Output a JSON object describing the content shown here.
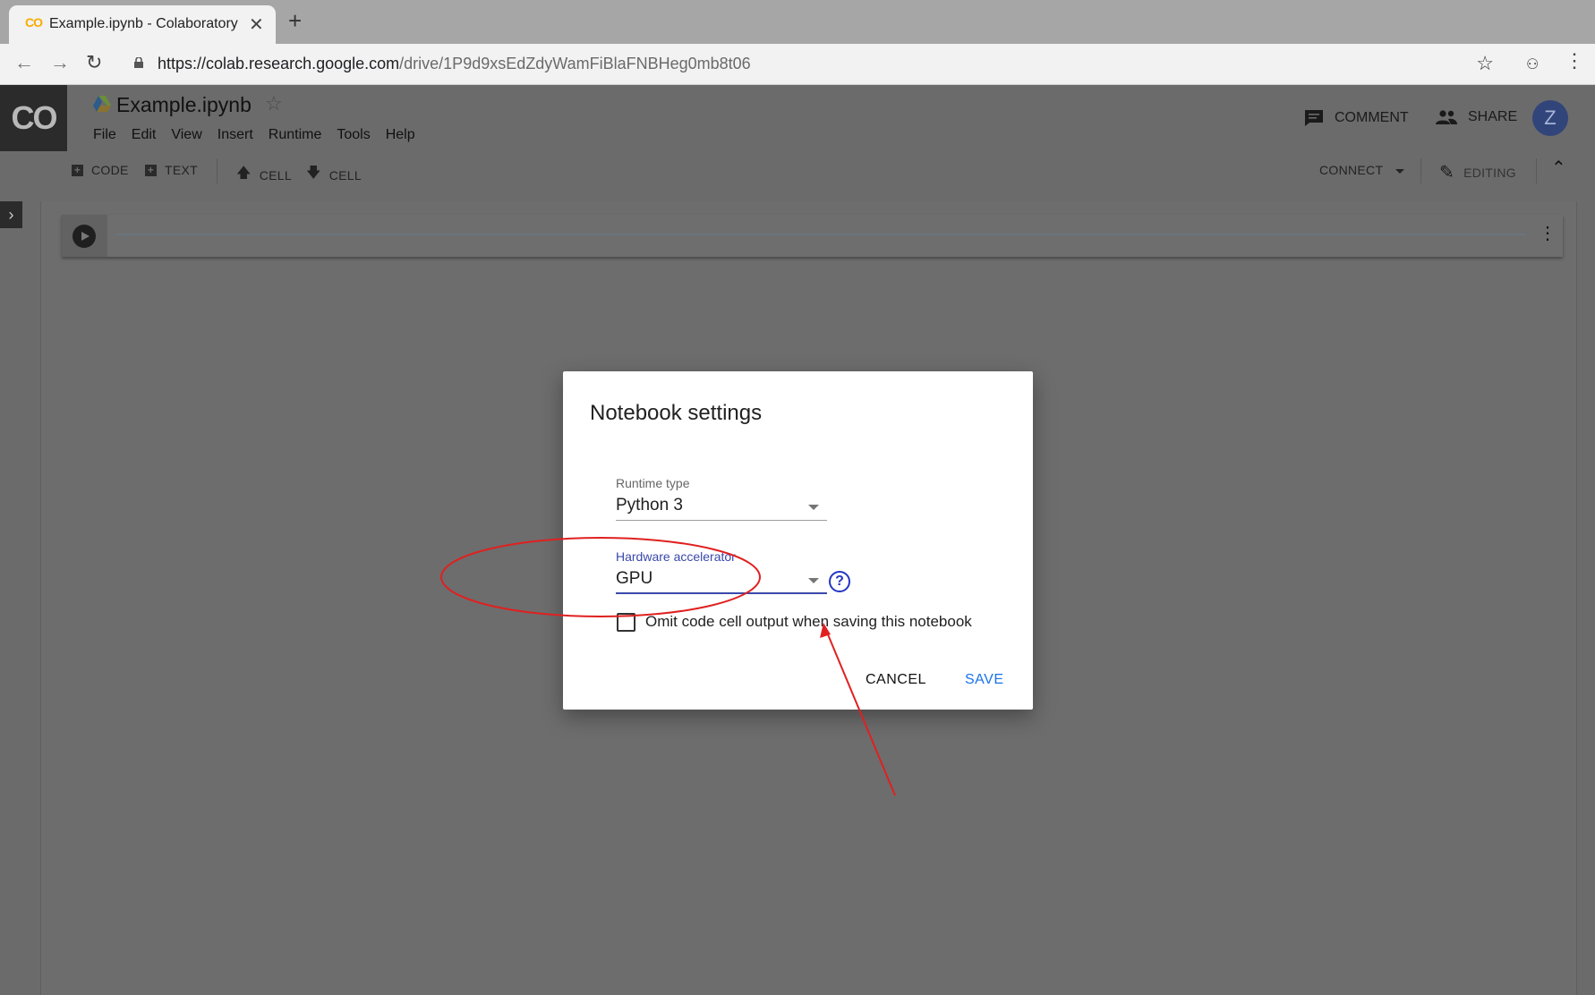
{
  "browser": {
    "tab_title": "Example.ipynb - Colaboratory",
    "tab_favicon": "CO",
    "tab_close": "✕",
    "new_tab": "+",
    "url_host": "https://colab.research.google.com",
    "url_path": "/drive/1P9d9xsEdZdyWamFiBlaFNBHeg0mb8t06"
  },
  "app": {
    "logo": "CO",
    "notebook_title": "Example.ipynb",
    "menu": [
      "File",
      "Edit",
      "View",
      "Insert",
      "Runtime",
      "Tools",
      "Help"
    ],
    "comment_label": "COMMENT",
    "share_label": "SHARE",
    "avatar_initial": "Z",
    "toolbar": {
      "code_label": "CODE",
      "text_label": "TEXT",
      "cell_up_label": "CELL",
      "cell_down_label": "CELL",
      "connect_label": "CONNECT",
      "editing_label": "EDITING"
    }
  },
  "dialog": {
    "title": "Notebook settings",
    "runtime_type": {
      "label": "Runtime type",
      "value": "Python 3"
    },
    "hardware_accelerator": {
      "label": "Hardware accelerator",
      "value": "GPU"
    },
    "omit_output": {
      "label": "Omit code cell output when saving this notebook",
      "checked": false
    },
    "cancel_label": "CANCEL",
    "save_label": "SAVE",
    "help_glyph": "?"
  },
  "annotation_color": "#e02020",
  "colors": {
    "accent": "#3949ab",
    "save": "#1a73e8",
    "avatar": "#31457a"
  }
}
